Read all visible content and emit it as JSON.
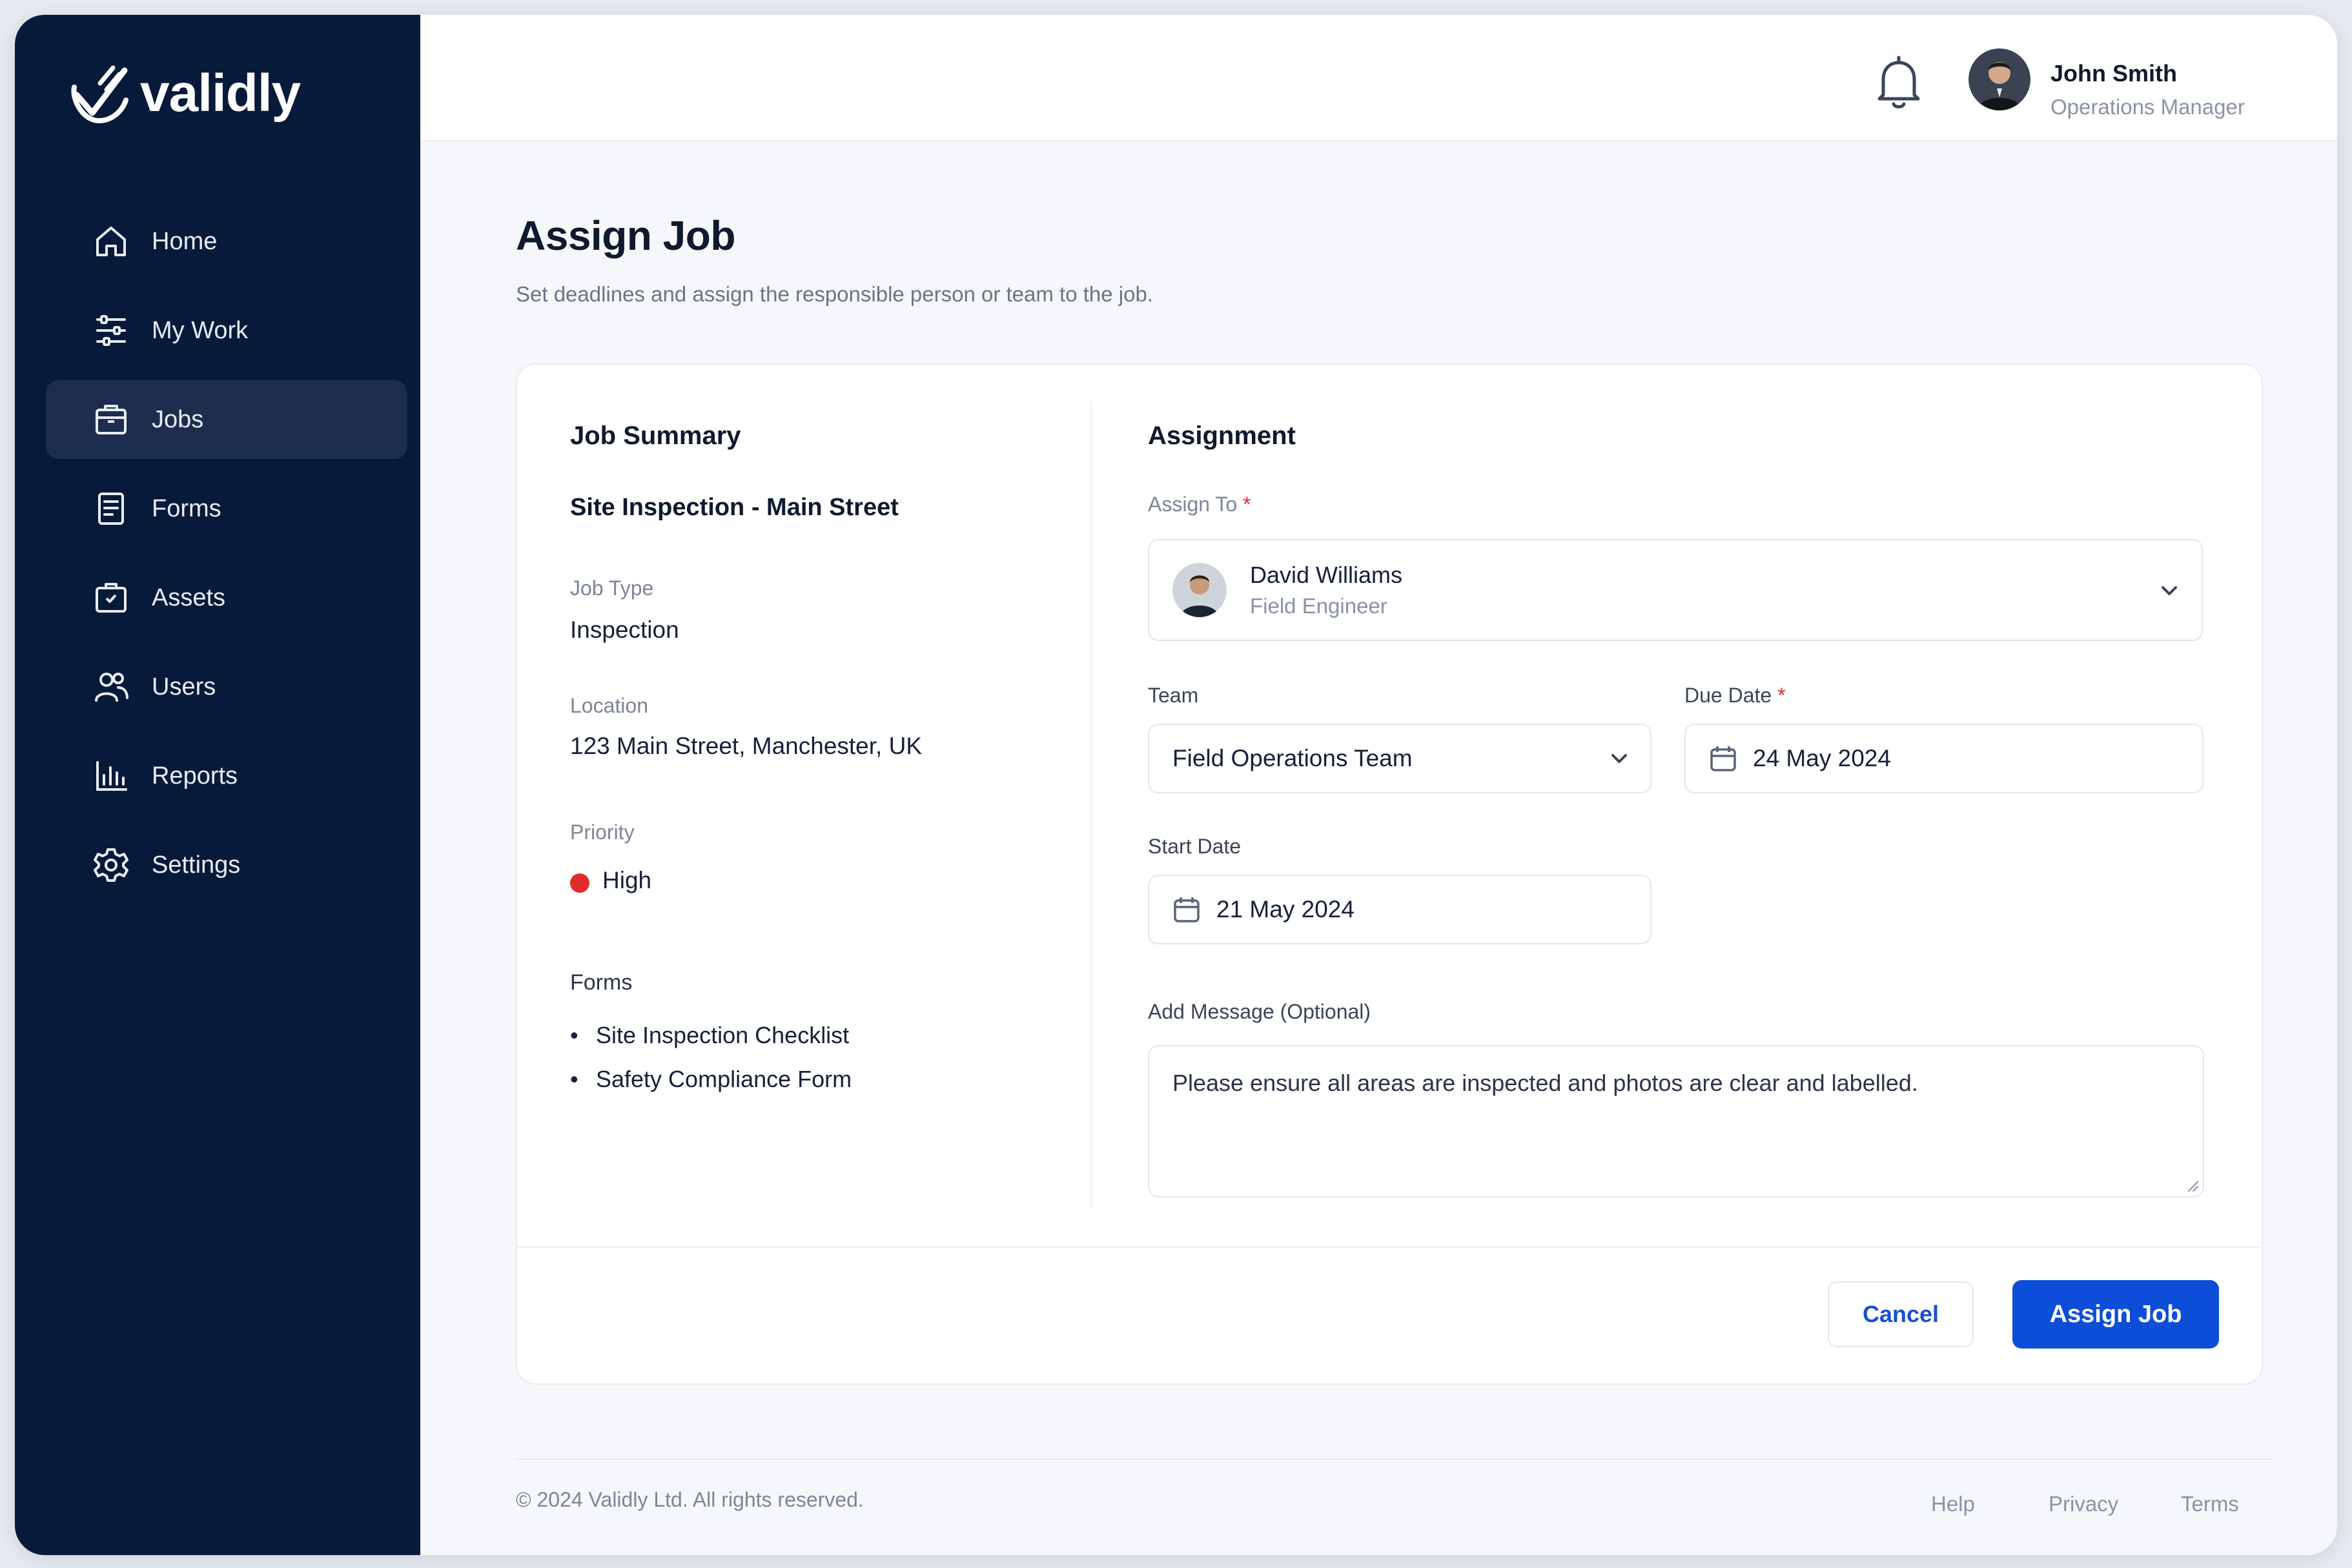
{
  "app": {
    "name": "validly"
  },
  "sidebar": {
    "items": [
      {
        "label": "Home",
        "icon": "home-icon"
      },
      {
        "label": "My Work",
        "icon": "sliders-icon"
      },
      {
        "label": "Jobs",
        "icon": "briefcase-icon",
        "active": true
      },
      {
        "label": "Forms",
        "icon": "document-icon"
      },
      {
        "label": "Assets",
        "icon": "box-icon"
      },
      {
        "label": "Users",
        "icon": "users-icon"
      },
      {
        "label": "Reports",
        "icon": "bar-chart-icon"
      },
      {
        "label": "Settings",
        "icon": "gear-icon"
      }
    ]
  },
  "header": {
    "user_name": "John Smith",
    "user_role": "Operations Manager"
  },
  "page": {
    "title": "Assign Job",
    "subtitle": "Set deadlines and assign the responsible person or team to the job."
  },
  "summary": {
    "heading": "Job Summary",
    "job_title": "Site Inspection - Main Street",
    "job_type_label": "Job Type",
    "job_type": "Inspection",
    "location_label": "Location",
    "location": "123 Main Street, Manchester, UK",
    "priority_label": "Priority",
    "priority": "High",
    "priority_color": "#e02b2b",
    "forms_label": "Forms",
    "forms": [
      "Site Inspection Checklist",
      "Safety Compliance Form"
    ]
  },
  "assignment": {
    "heading": "Assignment",
    "assign_to_label": "Assign To",
    "assignee_name": "David Williams",
    "assignee_role": "Field Engineer",
    "team_label": "Team",
    "team_value": "Field Operations Team",
    "due_date_label": "Due Date",
    "due_date": "24 May 2024",
    "start_date_label": "Start Date",
    "start_date": "21 May 2024",
    "message_label": "Add Message (Optional)",
    "message": "Please ensure all areas are inspected and photos are clear and labelled.",
    "required_mark": "*"
  },
  "actions": {
    "cancel": "Cancel",
    "assign": "Assign Job",
    "primary_color": "#0c4ed8"
  },
  "footer": {
    "copyright": "© 2024 Validly Ltd. All rights reserved.",
    "help": "Help",
    "privacy": "Privacy",
    "terms": "Terms"
  }
}
